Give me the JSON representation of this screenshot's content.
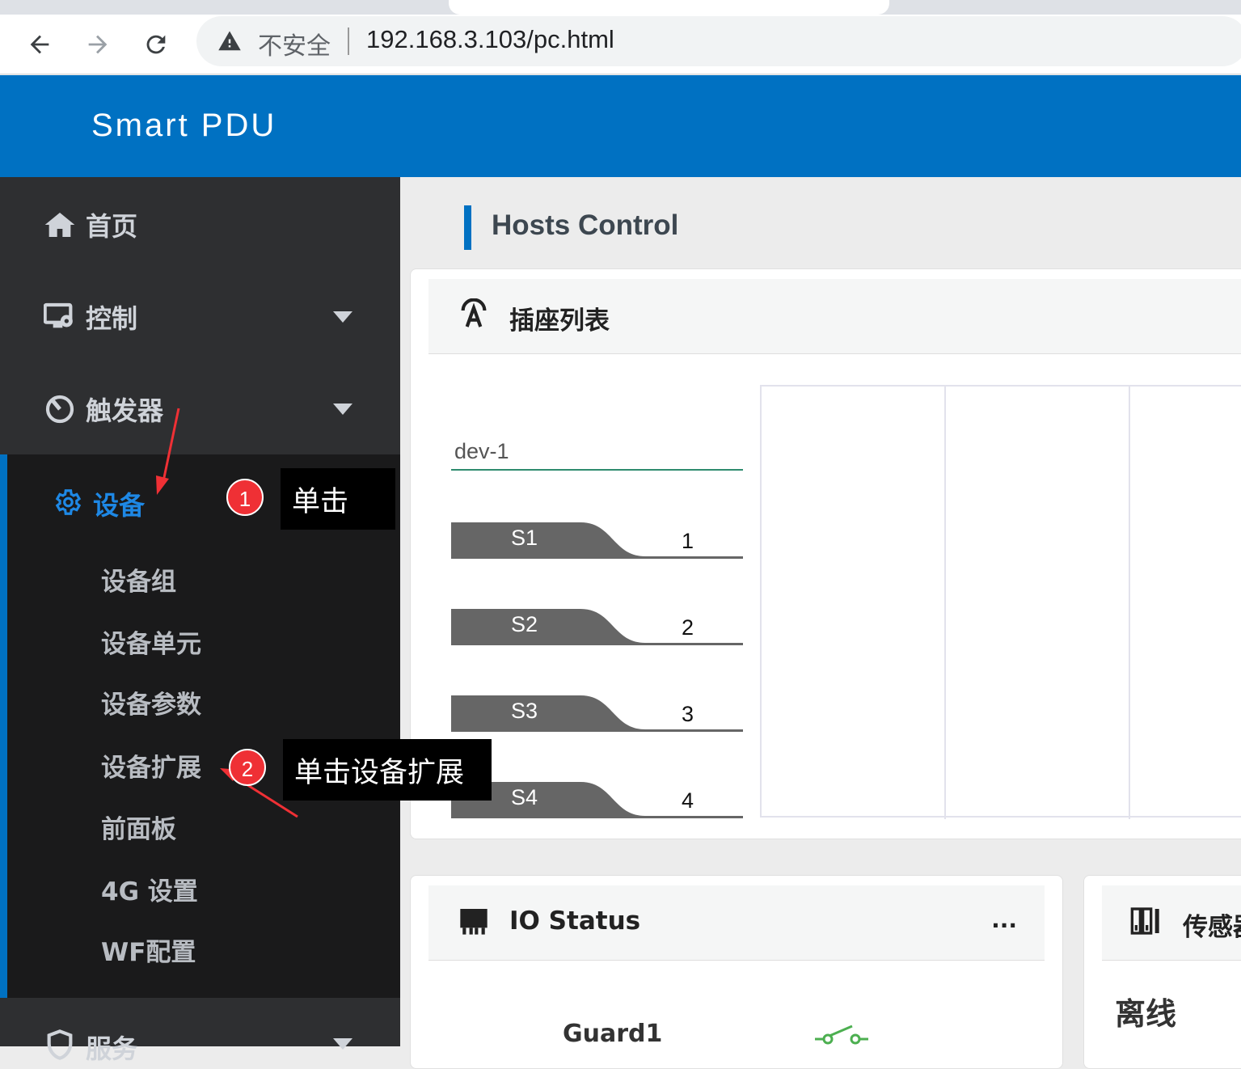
{
  "browser": {
    "back_icon": "arrow-left-icon",
    "forward_icon": "arrow-right-icon",
    "reload_icon": "reload-icon",
    "security_label": "不安全",
    "url": "192.168.3.103/pc.html"
  },
  "app": {
    "title": "Smart PDU"
  },
  "sidebar": {
    "items": [
      {
        "label": "首页",
        "icon": "home-icon"
      },
      {
        "label": "控制",
        "icon": "monitor-gear-icon",
        "expandable": true
      },
      {
        "label": "触发器",
        "icon": "timer-icon",
        "expandable": true
      }
    ],
    "device": {
      "label": "设备",
      "icon": "gear-icon",
      "sub_items": [
        "设备组",
        "设备单元",
        "设备参数",
        "设备扩展",
        "前面板",
        "4G 设置",
        "WF配置"
      ]
    },
    "service": {
      "label": "服务"
    }
  },
  "main": {
    "section_title": "Hosts Control",
    "socket_card": {
      "title": "插座列表",
      "icon": "socket-a-icon",
      "device_name": "dev-1",
      "sockets": [
        {
          "name": "S1",
          "number": "1"
        },
        {
          "name": "S2",
          "number": "2"
        },
        {
          "name": "S3",
          "number": "3"
        },
        {
          "name": "S4",
          "number": "4"
        }
      ]
    },
    "io_card": {
      "title": "IO Status",
      "icon": "chip-icon",
      "more": "...",
      "guard_label": "Guard1"
    },
    "sensor_card": {
      "title": "传感器",
      "icon": "sensor-icon",
      "status": "离线"
    }
  },
  "annotations": [
    {
      "number": "1",
      "text": "单击"
    },
    {
      "number": "2",
      "text": "单击设备扩展"
    }
  ],
  "colors": {
    "brand": "#0071c2",
    "sidebar": "#2e2f31",
    "active": "#1e88e5",
    "badge": "#ef3035"
  }
}
